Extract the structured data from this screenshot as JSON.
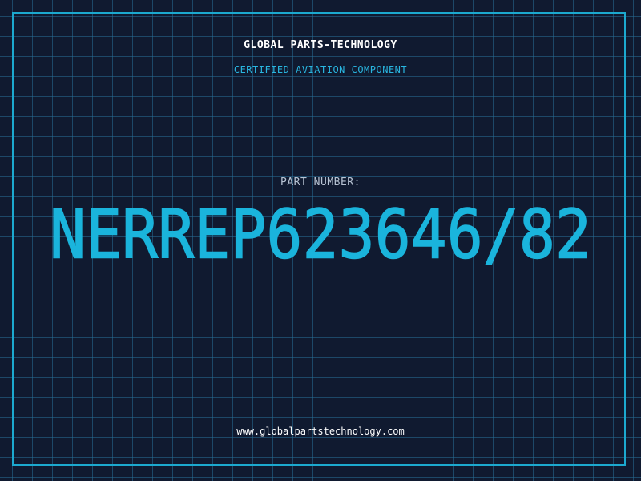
{
  "header": {
    "company": "GLOBAL PARTS-TECHNOLOGY",
    "subtitle": "CERTIFIED AVIATION COMPONENT"
  },
  "main": {
    "label": "PART NUMBER:",
    "part_number": "NERREP623646/82"
  },
  "footer": {
    "website": "www.globalpartstechnology.com"
  },
  "colors": {
    "background": "#101a30",
    "grid": "#286e96",
    "frame": "#1ca9cf",
    "accent": "#29b6e0",
    "part_number": "#1ab4dc",
    "label": "#b7c3d3",
    "text": "#ffffff"
  }
}
